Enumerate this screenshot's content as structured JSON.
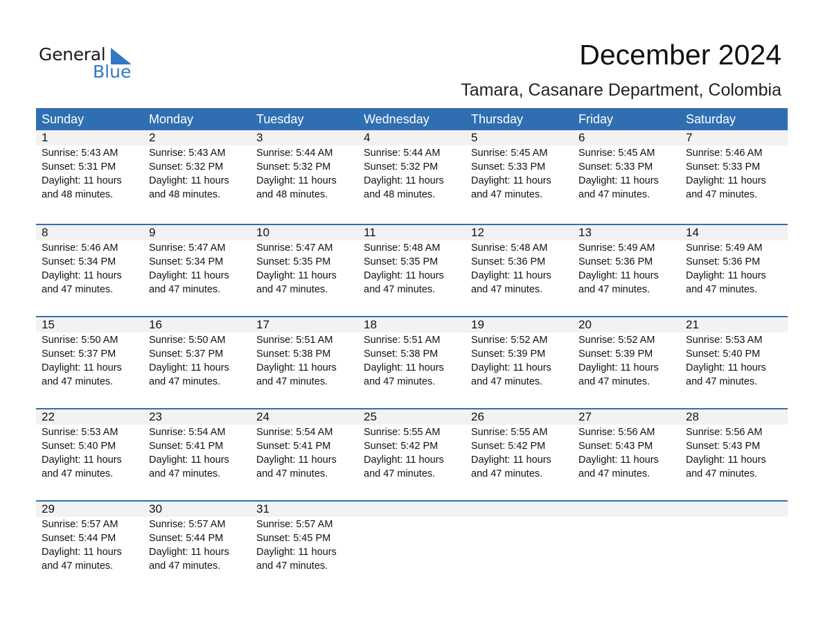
{
  "logo": {
    "text_general": "General",
    "text_blue": "Blue",
    "icon": "triangle-logo-icon"
  },
  "header": {
    "title": "December 2024",
    "subtitle": "Tamara, Casanare Department, Colombia"
  },
  "colors": {
    "accent": "#2f6fb1",
    "day_row_bg": "#f2f2f2",
    "logo_blue": "#2f78c4"
  },
  "weekdays": [
    "Sunday",
    "Monday",
    "Tuesday",
    "Wednesday",
    "Thursday",
    "Friday",
    "Saturday"
  ],
  "weeks": [
    [
      {
        "day": "1",
        "sunrise": "Sunrise: 5:43 AM",
        "sunset": "Sunset: 5:31 PM",
        "daylight1": "Daylight: 11 hours",
        "daylight2": "and 48 minutes."
      },
      {
        "day": "2",
        "sunrise": "Sunrise: 5:43 AM",
        "sunset": "Sunset: 5:32 PM",
        "daylight1": "Daylight: 11 hours",
        "daylight2": "and 48 minutes."
      },
      {
        "day": "3",
        "sunrise": "Sunrise: 5:44 AM",
        "sunset": "Sunset: 5:32 PM",
        "daylight1": "Daylight: 11 hours",
        "daylight2": "and 48 minutes."
      },
      {
        "day": "4",
        "sunrise": "Sunrise: 5:44 AM",
        "sunset": "Sunset: 5:32 PM",
        "daylight1": "Daylight: 11 hours",
        "daylight2": "and 48 minutes."
      },
      {
        "day": "5",
        "sunrise": "Sunrise: 5:45 AM",
        "sunset": "Sunset: 5:33 PM",
        "daylight1": "Daylight: 11 hours",
        "daylight2": "and 47 minutes."
      },
      {
        "day": "6",
        "sunrise": "Sunrise: 5:45 AM",
        "sunset": "Sunset: 5:33 PM",
        "daylight1": "Daylight: 11 hours",
        "daylight2": "and 47 minutes."
      },
      {
        "day": "7",
        "sunrise": "Sunrise: 5:46 AM",
        "sunset": "Sunset: 5:33 PM",
        "daylight1": "Daylight: 11 hours",
        "daylight2": "and 47 minutes."
      }
    ],
    [
      {
        "day": "8",
        "sunrise": "Sunrise: 5:46 AM",
        "sunset": "Sunset: 5:34 PM",
        "daylight1": "Daylight: 11 hours",
        "daylight2": "and 47 minutes."
      },
      {
        "day": "9",
        "sunrise": "Sunrise: 5:47 AM",
        "sunset": "Sunset: 5:34 PM",
        "daylight1": "Daylight: 11 hours",
        "daylight2": "and 47 minutes."
      },
      {
        "day": "10",
        "sunrise": "Sunrise: 5:47 AM",
        "sunset": "Sunset: 5:35 PM",
        "daylight1": "Daylight: 11 hours",
        "daylight2": "and 47 minutes."
      },
      {
        "day": "11",
        "sunrise": "Sunrise: 5:48 AM",
        "sunset": "Sunset: 5:35 PM",
        "daylight1": "Daylight: 11 hours",
        "daylight2": "and 47 minutes."
      },
      {
        "day": "12",
        "sunrise": "Sunrise: 5:48 AM",
        "sunset": "Sunset: 5:36 PM",
        "daylight1": "Daylight: 11 hours",
        "daylight2": "and 47 minutes."
      },
      {
        "day": "13",
        "sunrise": "Sunrise: 5:49 AM",
        "sunset": "Sunset: 5:36 PM",
        "daylight1": "Daylight: 11 hours",
        "daylight2": "and 47 minutes."
      },
      {
        "day": "14",
        "sunrise": "Sunrise: 5:49 AM",
        "sunset": "Sunset: 5:36 PM",
        "daylight1": "Daylight: 11 hours",
        "daylight2": "and 47 minutes."
      }
    ],
    [
      {
        "day": "15",
        "sunrise": "Sunrise: 5:50 AM",
        "sunset": "Sunset: 5:37 PM",
        "daylight1": "Daylight: 11 hours",
        "daylight2": "and 47 minutes."
      },
      {
        "day": "16",
        "sunrise": "Sunrise: 5:50 AM",
        "sunset": "Sunset: 5:37 PM",
        "daylight1": "Daylight: 11 hours",
        "daylight2": "and 47 minutes."
      },
      {
        "day": "17",
        "sunrise": "Sunrise: 5:51 AM",
        "sunset": "Sunset: 5:38 PM",
        "daylight1": "Daylight: 11 hours",
        "daylight2": "and 47 minutes."
      },
      {
        "day": "18",
        "sunrise": "Sunrise: 5:51 AM",
        "sunset": "Sunset: 5:38 PM",
        "daylight1": "Daylight: 11 hours",
        "daylight2": "and 47 minutes."
      },
      {
        "day": "19",
        "sunrise": "Sunrise: 5:52 AM",
        "sunset": "Sunset: 5:39 PM",
        "daylight1": "Daylight: 11 hours",
        "daylight2": "and 47 minutes."
      },
      {
        "day": "20",
        "sunrise": "Sunrise: 5:52 AM",
        "sunset": "Sunset: 5:39 PM",
        "daylight1": "Daylight: 11 hours",
        "daylight2": "and 47 minutes."
      },
      {
        "day": "21",
        "sunrise": "Sunrise: 5:53 AM",
        "sunset": "Sunset: 5:40 PM",
        "daylight1": "Daylight: 11 hours",
        "daylight2": "and 47 minutes."
      }
    ],
    [
      {
        "day": "22",
        "sunrise": "Sunrise: 5:53 AM",
        "sunset": "Sunset: 5:40 PM",
        "daylight1": "Daylight: 11 hours",
        "daylight2": "and 47 minutes."
      },
      {
        "day": "23",
        "sunrise": "Sunrise: 5:54 AM",
        "sunset": "Sunset: 5:41 PM",
        "daylight1": "Daylight: 11 hours",
        "daylight2": "and 47 minutes."
      },
      {
        "day": "24",
        "sunrise": "Sunrise: 5:54 AM",
        "sunset": "Sunset: 5:41 PM",
        "daylight1": "Daylight: 11 hours",
        "daylight2": "and 47 minutes."
      },
      {
        "day": "25",
        "sunrise": "Sunrise: 5:55 AM",
        "sunset": "Sunset: 5:42 PM",
        "daylight1": "Daylight: 11 hours",
        "daylight2": "and 47 minutes."
      },
      {
        "day": "26",
        "sunrise": "Sunrise: 5:55 AM",
        "sunset": "Sunset: 5:42 PM",
        "daylight1": "Daylight: 11 hours",
        "daylight2": "and 47 minutes."
      },
      {
        "day": "27",
        "sunrise": "Sunrise: 5:56 AM",
        "sunset": "Sunset: 5:43 PM",
        "daylight1": "Daylight: 11 hours",
        "daylight2": "and 47 minutes."
      },
      {
        "day": "28",
        "sunrise": "Sunrise: 5:56 AM",
        "sunset": "Sunset: 5:43 PM",
        "daylight1": "Daylight: 11 hours",
        "daylight2": "and 47 minutes."
      }
    ],
    [
      {
        "day": "29",
        "sunrise": "Sunrise: 5:57 AM",
        "sunset": "Sunset: 5:44 PM",
        "daylight1": "Daylight: 11 hours",
        "daylight2": "and 47 minutes."
      },
      {
        "day": "30",
        "sunrise": "Sunrise: 5:57 AM",
        "sunset": "Sunset: 5:44 PM",
        "daylight1": "Daylight: 11 hours",
        "daylight2": "and 47 minutes."
      },
      {
        "day": "31",
        "sunrise": "Sunrise: 5:57 AM",
        "sunset": "Sunset: 5:45 PM",
        "daylight1": "Daylight: 11 hours",
        "daylight2": "and 47 minutes."
      },
      {
        "day": "",
        "sunrise": "",
        "sunset": "",
        "daylight1": "",
        "daylight2": ""
      },
      {
        "day": "",
        "sunrise": "",
        "sunset": "",
        "daylight1": "",
        "daylight2": ""
      },
      {
        "day": "",
        "sunrise": "",
        "sunset": "",
        "daylight1": "",
        "daylight2": ""
      },
      {
        "day": "",
        "sunrise": "",
        "sunset": "",
        "daylight1": "",
        "daylight2": ""
      }
    ]
  ]
}
